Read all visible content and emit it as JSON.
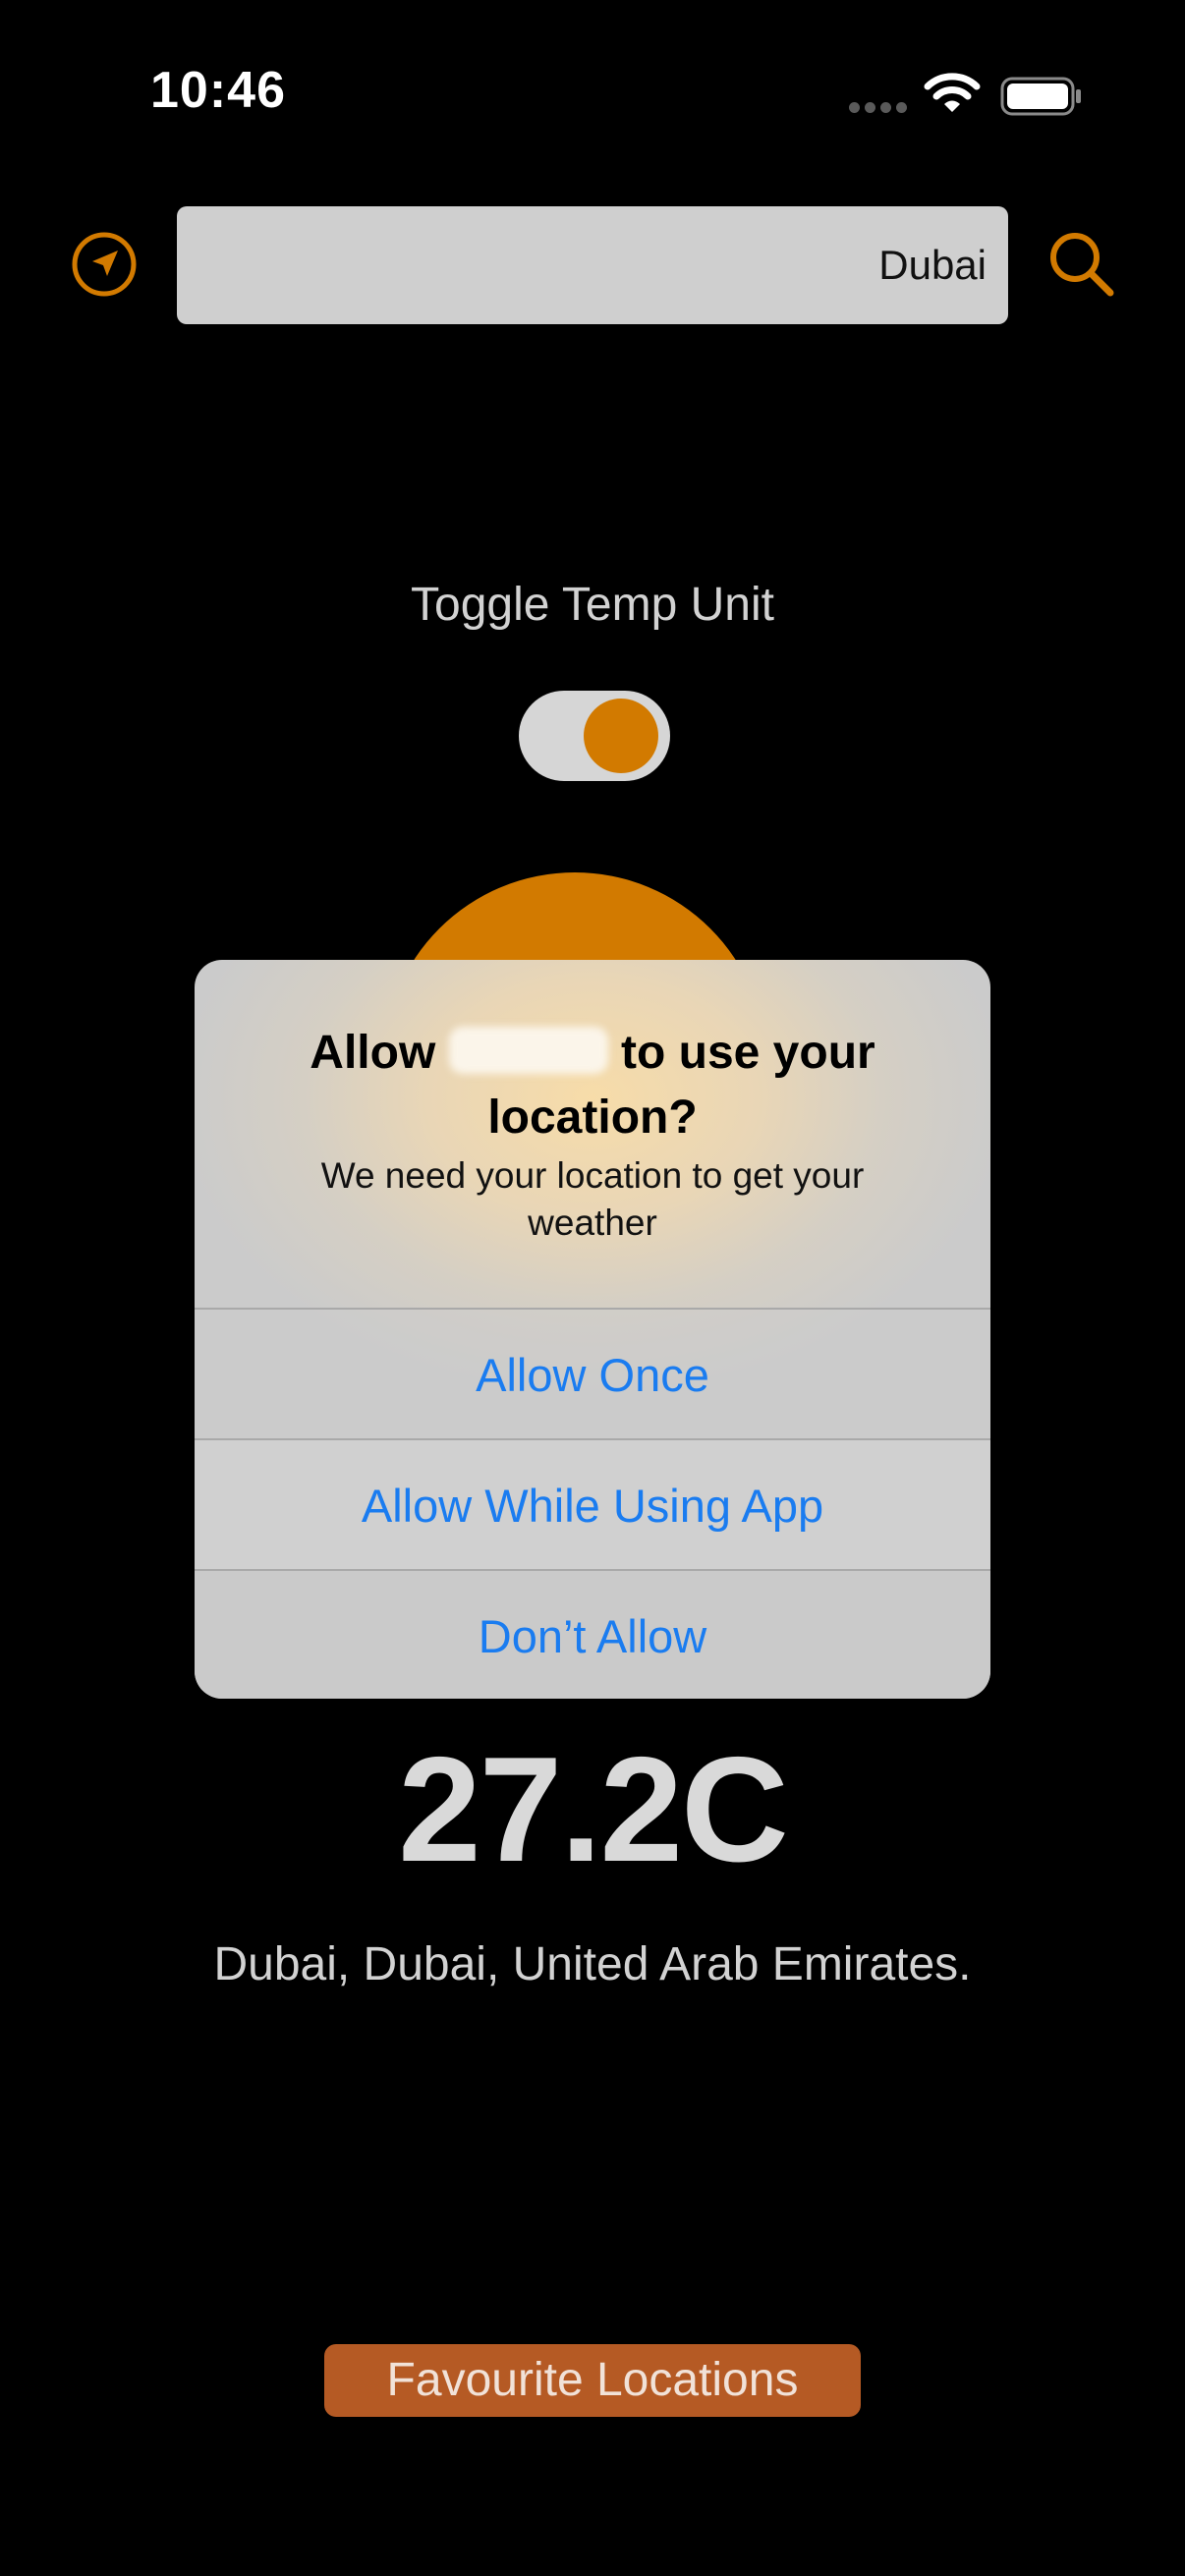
{
  "status_bar": {
    "time": "10:46"
  },
  "header": {
    "search_value": "Dubai",
    "location_icon": "navigation-arrow-icon",
    "search_icon": "search-icon"
  },
  "toggle": {
    "label": "Toggle Temp Unit",
    "state": "on"
  },
  "weather": {
    "temperature": "27.2C",
    "location": "Dubai,  Dubai, United Arab Emirates."
  },
  "footer": {
    "favourites_label": "Favourite Locations"
  },
  "alert": {
    "title_prefix": "Allow",
    "title_suffix": "to use your location?",
    "message": "We need your location to get your weather",
    "buttons": [
      "Allow Once",
      "Allow While Using App",
      "Don’t Allow"
    ]
  },
  "colors": {
    "accent": "#d27a00",
    "alert_button_text": "#1a7cf0",
    "favourites_bg": "#b55a24"
  }
}
